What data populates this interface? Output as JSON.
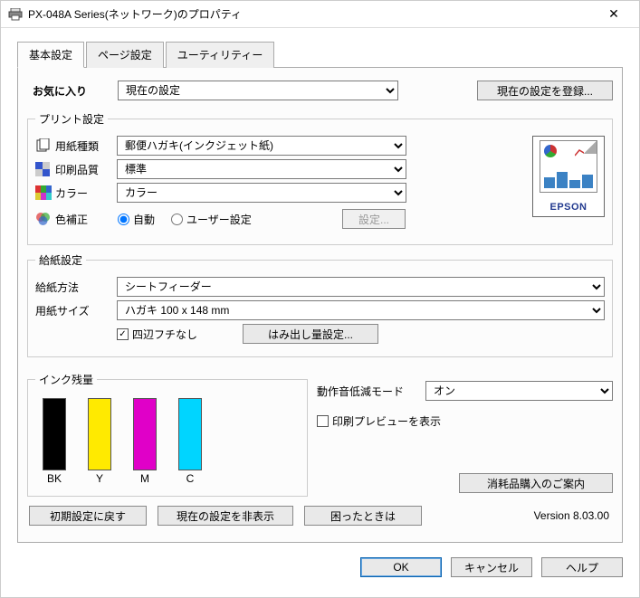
{
  "title": "PX-048A Series(ネットワーク)のプロパティ",
  "tabs": {
    "basic": "基本設定",
    "page": "ページ設定",
    "utility": "ユーティリティー"
  },
  "favorites": {
    "label": "お気に入り",
    "value": "現在の設定",
    "register": "現在の設定を登録..."
  },
  "print": {
    "legend": "プリント設定",
    "paper_type_label": "用紙種類",
    "paper_type_value": "郵便ハガキ(インクジェット紙)",
    "quality_label": "印刷品質",
    "quality_value": "標準",
    "color_label": "カラー",
    "color_value": "カラー",
    "color_correction_label": "色補正",
    "color_correction_auto": "自動",
    "color_correction_user": "ユーザー設定",
    "color_correction_btn": "設定...",
    "brand": "EPSON"
  },
  "feed": {
    "legend": "給紙設定",
    "method_label": "給紙方法",
    "method_value": "シートフィーダー",
    "size_label": "用紙サイズ",
    "size_value": "ハガキ 100 x 148 mm",
    "borderless_label": "四辺フチなし",
    "borderless_btn": "はみ出し量設定..."
  },
  "ink": {
    "legend": "インク残量",
    "BK": "BK",
    "Y": "Y",
    "M": "M",
    "C": "C"
  },
  "right": {
    "quiet_label": "動作音低減モード",
    "quiet_value": "オン",
    "preview_label": "印刷プレビューを表示",
    "consumables": "消耗品購入のご案内"
  },
  "bottom": {
    "defaults": "初期設定に戻す",
    "hide": "現在の設定を非表示",
    "help_guide": "困ったときは",
    "version": "Version 8.03.00"
  },
  "footer": {
    "ok": "OK",
    "cancel": "キャンセル",
    "help": "ヘルプ"
  }
}
